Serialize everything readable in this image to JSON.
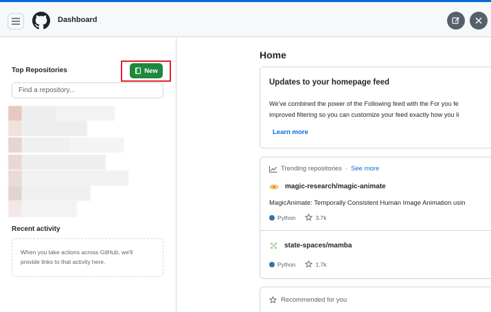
{
  "header": {
    "title": "Dashboard",
    "menu_icon": "hamburger-icon",
    "logo_icon": "github-logo-icon",
    "right_icons": [
      "edit-icon",
      "close-icon"
    ]
  },
  "sidebar": {
    "top_repos_heading": "Top Repositories",
    "new_button_label": "New",
    "find_placeholder": "Find a repository...",
    "recent_activity_heading": "Recent activity",
    "recent_activity_text_line1": "When you take actions across GitHub, we'll",
    "recent_activity_text_line2": "provide links to that activity here."
  },
  "main": {
    "title": "Home",
    "updates_card": {
      "title": "Updates to your homepage feed",
      "body_line1": "We've combined the power of the Following feed with the For you fe",
      "body_line2": "improved filtering so you can customize your feed exactly how you li",
      "link": "Learn more"
    },
    "trending": {
      "label": "Trending repositories",
      "separator": "·",
      "see_more": "See more",
      "repos": [
        {
          "name": "magic-research/magic-animate",
          "description": "MagicAnimate: Temporally Consistent Human Image Animation usin",
          "language": "Python",
          "stars": "3.7k"
        },
        {
          "name": "state-spaces/mamba",
          "description": "",
          "language": "Python",
          "stars": "1.7k"
        }
      ]
    },
    "recommended": {
      "label": "Recommended for you"
    }
  },
  "colors": {
    "accent_link": "#0969da",
    "new_button": "#1f883d",
    "highlight_box": "#e5202a",
    "python_lang": "#3572a5"
  }
}
